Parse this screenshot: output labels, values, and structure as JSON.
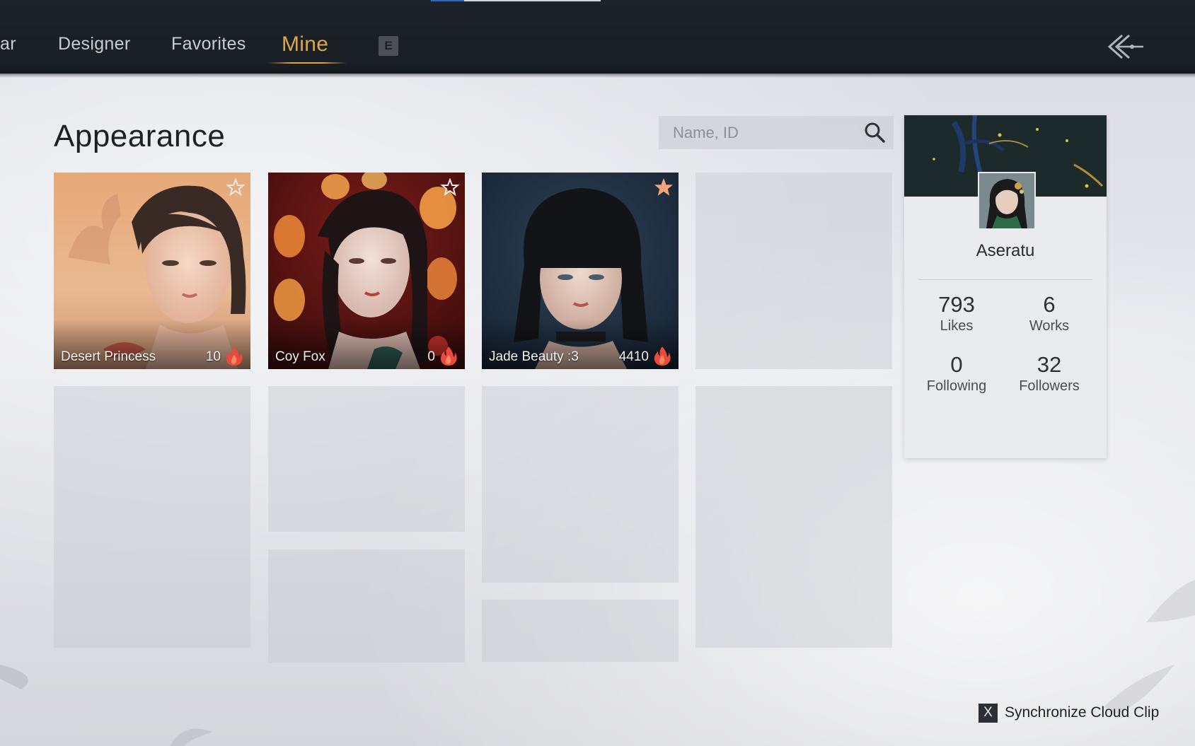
{
  "tabs": [
    {
      "label": "ar",
      "active": false
    },
    {
      "label": "Designer",
      "active": false
    },
    {
      "label": "Favorites",
      "active": false
    },
    {
      "label": "Mine",
      "active": true
    }
  ],
  "tab_key_hint": "E",
  "page": {
    "title": "Appearance"
  },
  "search": {
    "placeholder": "Name, ID",
    "value": ""
  },
  "cards": [
    {
      "name": "Desert Princess",
      "count": "10",
      "favorited": false
    },
    {
      "name": "Coy Fox",
      "count": "0",
      "favorited": false
    },
    {
      "name": "Jade Beauty :3",
      "count": "4410",
      "favorited": true
    }
  ],
  "profile": {
    "username": "Aseratu",
    "stats": {
      "likes": {
        "value": "793",
        "label": "Likes"
      },
      "works": {
        "value": "6",
        "label": "Works"
      },
      "following": {
        "value": "0",
        "label": "Following"
      },
      "followers": {
        "value": "32",
        "label": "Followers"
      }
    }
  },
  "sync": {
    "key": "X",
    "label": "Synchronize Cloud Clip"
  },
  "colors": {
    "accent": "#d9a64b",
    "topbar": "#1d2329",
    "flame": "#e84b3c",
    "star_active": "#f2a57a"
  },
  "icons": {
    "search": "search-icon",
    "back": "back-arrow-icon",
    "flame": "flame-icon",
    "star": "star-icon"
  }
}
